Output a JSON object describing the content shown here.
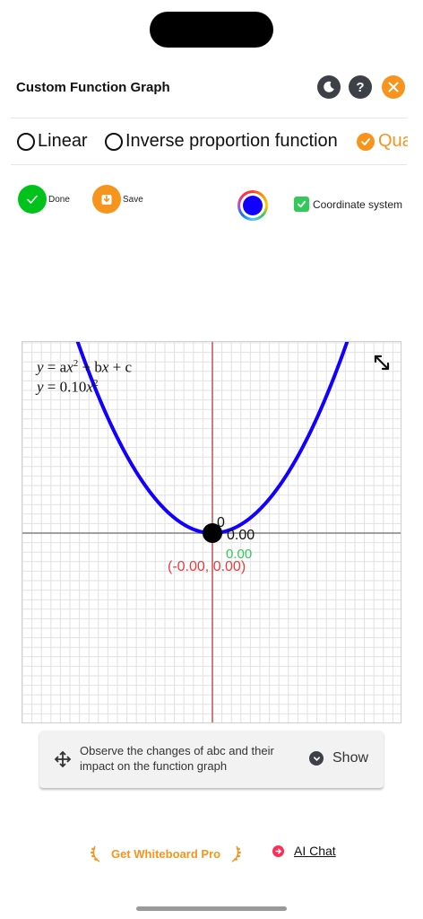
{
  "header": {
    "title": "Custom Function Graph"
  },
  "tabs": [
    {
      "label": "Linear",
      "selected": false
    },
    {
      "label": "Inverse proportion function",
      "selected": false
    },
    {
      "label": "Qua",
      "selected": true
    }
  ],
  "toolbar": {
    "done_label": "Done",
    "save_label": "Save",
    "selected_color": "#1200ff",
    "coordinate_system_label": "Coordinate system",
    "coordinate_system_checked": true
  },
  "graph": {
    "equation_general": {
      "y": "y",
      "eq": "= a",
      "x": "x",
      "sup": "2",
      "rest": "+ b",
      "x2": "x",
      "tail": "+ c"
    },
    "equation_specific": {
      "y": "y",
      "eq": "=  0.10",
      "x": "x",
      "sup": "2"
    },
    "coefficient_a": 0.1,
    "origin_label": "0",
    "value_label_black": "0.00",
    "value_label_green": "0.00",
    "point_coordinates": "(-0.00, 0.00)",
    "curve_color": "#1200ff",
    "axis_y_color": "#c0504d",
    "axis_x_color": "#808080"
  },
  "observe": {
    "text": "Observe the changes of abc and their impact on the function graph",
    "show_label": "Show"
  },
  "footer": {
    "pro_label": "Get Whiteboard Pro",
    "ai_label": "AI Chat"
  },
  "colors": {
    "accent": "#f7941d",
    "done_green": "#00c21a",
    "checkbox_green": "#34c759",
    "ai_red": "#ff2d55"
  }
}
